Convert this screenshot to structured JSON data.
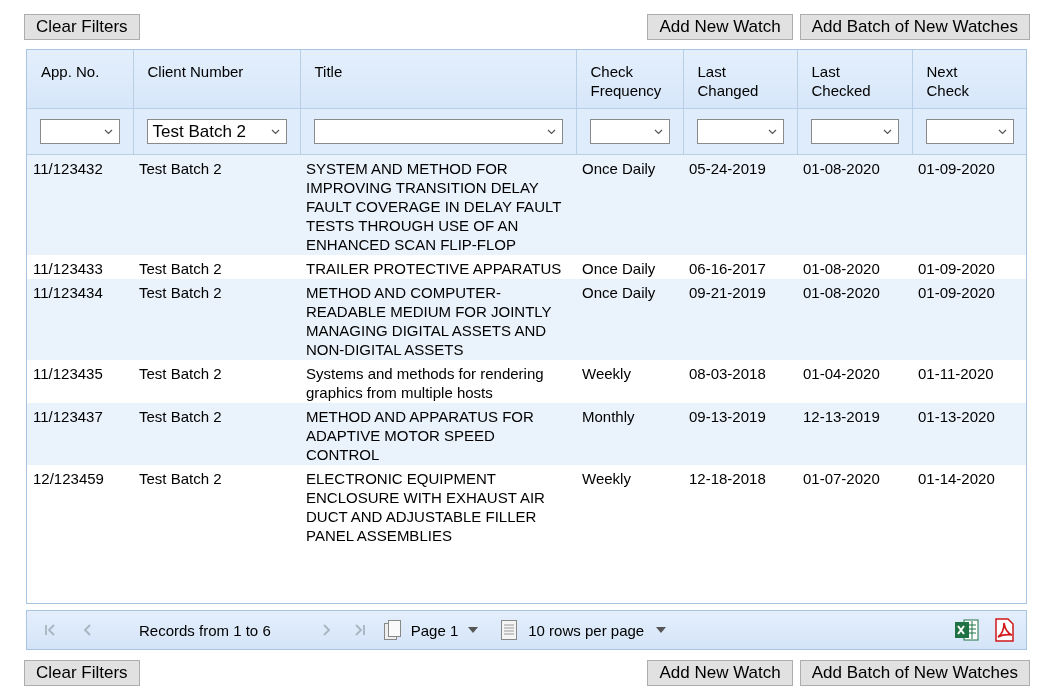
{
  "top_actions": {
    "left": [
      "Clear Filters"
    ],
    "right": [
      "Add New Watch",
      "Add Batch of New Watches"
    ]
  },
  "table": {
    "columns": [
      {
        "label": "App. No."
      },
      {
        "label": "Client Number",
        "filter": "Test Batch 2"
      },
      {
        "label": "Title"
      },
      {
        "label": "Check Frequency"
      },
      {
        "label": "Last Changed"
      },
      {
        "label": "Last Checked"
      },
      {
        "label": "Next Check"
      }
    ],
    "rows": [
      [
        "11/123432",
        "Test Batch 2",
        "SYSTEM AND METHOD FOR IMPROVING TRANSITION DELAY FAULT COVERAGE IN DELAY FAULT TESTS THROUGH USE OF AN ENHANCED SCAN FLIP-FLOP",
        "Once Daily",
        "05-24-2019",
        "01-08-2020",
        "01-09-2020"
      ],
      [
        "11/123433",
        "Test Batch 2",
        "TRAILER PROTECTIVE APPARATUS",
        "Once Daily",
        "06-16-2017",
        "01-08-2020",
        "01-09-2020"
      ],
      [
        "11/123434",
        "Test Batch 2",
        "METHOD AND COMPUTER-READABLE MEDIUM FOR JOINTLY MANAGING DIGITAL ASSETS AND NON-DIGITAL ASSETS",
        "Once Daily",
        "09-21-2019",
        "01-08-2020",
        "01-09-2020"
      ],
      [
        "11/123435",
        "Test Batch 2",
        "Systems and methods for rendering graphics from multiple hosts",
        "Weekly",
        "08-03-2018",
        "01-04-2020",
        "01-11-2020"
      ],
      [
        "11/123437",
        "Test Batch 2",
        "METHOD AND APPARATUS FOR ADAPTIVE MOTOR SPEED CONTROL",
        "Monthly",
        "09-13-2019",
        "12-13-2019",
        "01-13-2020"
      ],
      [
        "12/123459",
        "Test Batch 2",
        "ELECTRONIC EQUIPMENT ENCLOSURE WITH EXHAUST AIR DUCT AND ADJUSTABLE FILLER PANEL ASSEMBLIES",
        "Weekly",
        "12-18-2018",
        "01-07-2020",
        "01-14-2020"
      ]
    ]
  },
  "pager": {
    "records": "Records from 1 to 6",
    "page": "Page 1",
    "rows_per_page": "10 rows per page"
  },
  "bottom_actions": {
    "left": [
      "Clear Filters"
    ],
    "right": [
      "Add New Watch",
      "Add Batch of New Watches"
    ]
  }
}
